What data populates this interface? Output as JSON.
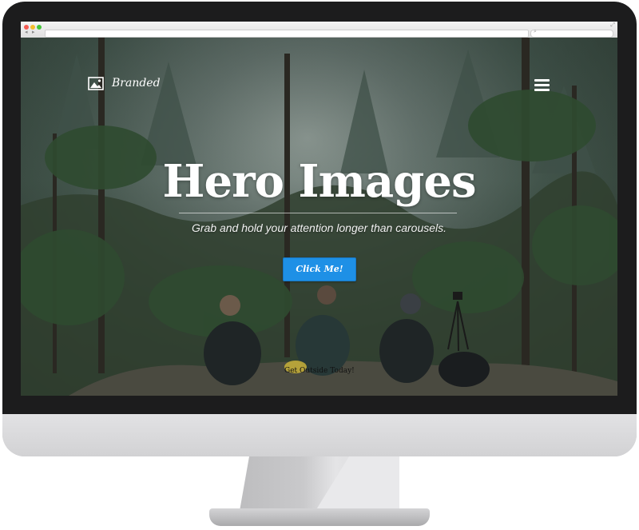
{
  "site": {
    "brand_name": "Branded",
    "hero_title": "Hero Images",
    "hero_subtitle": "Grab and hold your attention longer than carousels.",
    "cta_label": "Click Me!",
    "caption": "Get Outside Today!"
  },
  "icons": {
    "brand": "image-icon",
    "menu": "hamburger-menu-icon",
    "search": "search-icon",
    "expand": "expand-icon"
  },
  "colors": {
    "cta": "#1e90e6",
    "bezel": "#1c1c1d",
    "chin": "#dcdcde"
  }
}
